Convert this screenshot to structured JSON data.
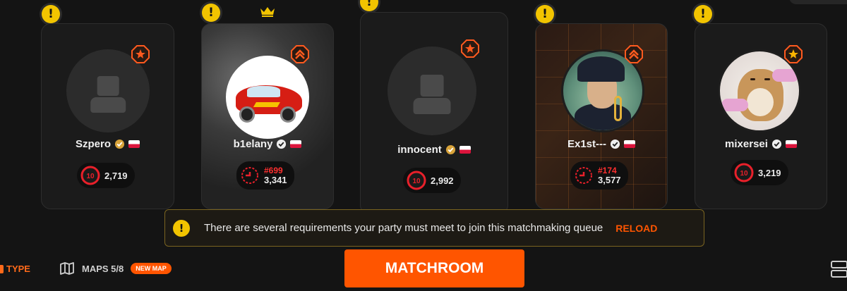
{
  "players": [
    {
      "name": "Szpero",
      "elo": "2,719",
      "level": "10",
      "rank": ""
    },
    {
      "name": "b1elany",
      "elo": "3,341",
      "level": "",
      "rank": "#699"
    },
    {
      "name": "innocent",
      "elo": "2,992",
      "level": "10",
      "rank": ""
    },
    {
      "name": "Ex1st---",
      "elo": "3,577",
      "level": "",
      "rank": "#174"
    },
    {
      "name": "mixersei",
      "elo": "3,219",
      "level": "10",
      "rank": ""
    }
  ],
  "notice": {
    "text": "There are several requirements your party must meet to join this matchmaking queue",
    "action": "RELOAD"
  },
  "bottom_bar": {
    "type_label": "TYPE",
    "maps_label": "MAPS 5/8",
    "new_map_badge": "NEW MAP",
    "matchroom_label": "MATCHROOM"
  },
  "colors": {
    "accent": "#ff5500",
    "warning": "#f2c400",
    "level_red": "#e8202a",
    "background": "#141414",
    "card": "#1b1b1b"
  },
  "icons": [
    "warning-icon",
    "crown-icon",
    "rank-badge-icon",
    "verified-icon",
    "flag-icon",
    "level-10-icon",
    "challenger-icon",
    "map-icon",
    "server-icon"
  ]
}
